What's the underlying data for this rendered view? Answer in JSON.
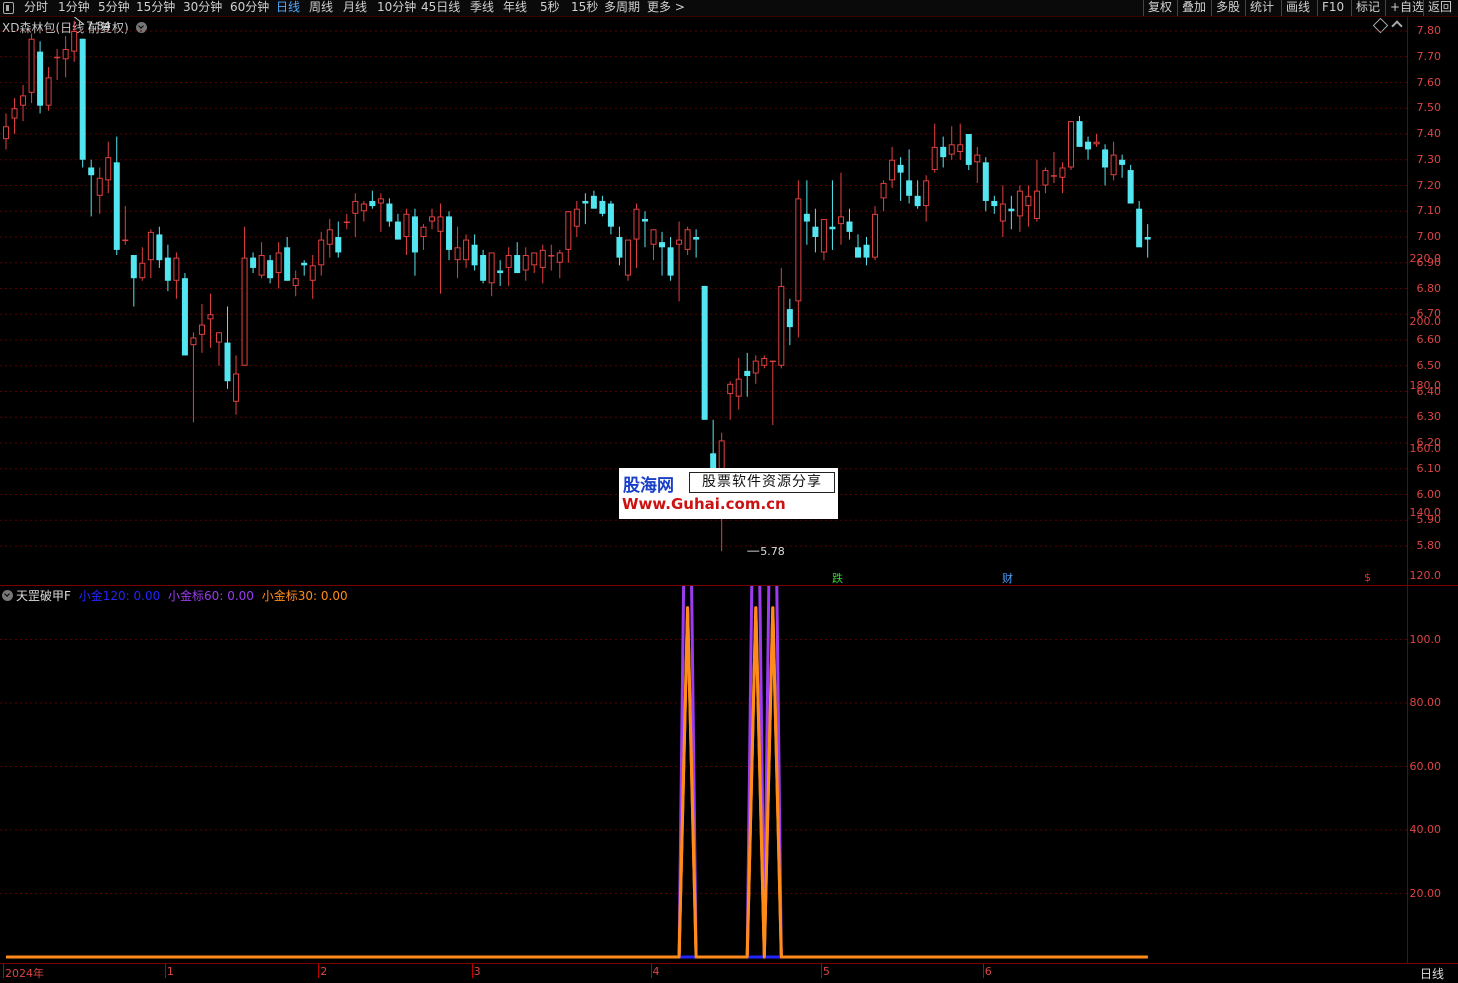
{
  "toolbar": {
    "tabs": [
      "分时",
      "1分钟",
      "5分钟",
      "15分钟",
      "30分钟",
      "60分钟",
      "日线",
      "周线",
      "月线",
      "10分钟",
      "45日线",
      "季线",
      "年线",
      "5秒",
      "15秒",
      "多周期",
      "更多 >"
    ],
    "active_tab": "日线",
    "right_buttons": [
      "复权",
      "叠加",
      "多股",
      "统计",
      "画线",
      "F10",
      "标记",
      "+自选",
      "返回"
    ]
  },
  "main_panel": {
    "title": "XD森林包(日线 前复权)",
    "high_label": "7.84",
    "low_label": "5.78",
    "badges": {
      "die": "跌",
      "cai": "财",
      "dollar": "$"
    },
    "y_ticks": [
      "7.80",
      "7.70",
      "7.60",
      "7.50",
      "7.40",
      "7.30",
      "7.20",
      "7.10",
      "7.00",
      "6.90",
      "6.80",
      "6.70",
      "6.60",
      "6.50",
      "6.40",
      "6.30",
      "6.20",
      "6.10",
      "6.00",
      "5.90",
      "5.80"
    ],
    "colors": {
      "up": "#e04040",
      "down": "#54e6f0",
      "grid": "#5a0000"
    }
  },
  "candles": [
    [
      7.38,
      7.48,
      7.34,
      7.43
    ],
    [
      7.46,
      7.54,
      7.4,
      7.5
    ],
    [
      7.51,
      7.59,
      7.45,
      7.55
    ],
    [
      7.56,
      7.79,
      7.52,
      7.77
    ],
    [
      7.72,
      7.76,
      7.48,
      7.51
    ],
    [
      7.51,
      7.66,
      7.49,
      7.62
    ],
    [
      7.7,
      7.73,
      7.61,
      7.7
    ],
    [
      7.69,
      7.78,
      7.62,
      7.73
    ],
    [
      7.72,
      7.84,
      7.68,
      7.8
    ],
    [
      7.77,
      7.77,
      7.27,
      7.3
    ],
    [
      7.27,
      7.3,
      7.08,
      7.24
    ],
    [
      7.16,
      7.27,
      7.09,
      7.23
    ],
    [
      7.22,
      7.37,
      7.17,
      7.31
    ],
    [
      7.29,
      7.39,
      6.93,
      6.95
    ],
    [
      6.99,
      7.12,
      6.97,
      6.99
    ],
    [
      6.93,
      6.93,
      6.73,
      6.84
    ],
    [
      6.84,
      6.96,
      6.83,
      6.9
    ],
    [
      6.91,
      7.03,
      6.84,
      7.02
    ],
    [
      7.01,
      7.04,
      6.88,
      6.91
    ],
    [
      6.92,
      6.97,
      6.79,
      6.83
    ],
    [
      6.83,
      6.94,
      6.76,
      6.92
    ],
    [
      6.84,
      6.86,
      6.55,
      6.54
    ],
    [
      6.58,
      6.63,
      6.28,
      6.61
    ],
    [
      6.62,
      6.74,
      6.55,
      6.66
    ],
    [
      6.68,
      6.78,
      6.57,
      6.7
    ],
    [
      6.59,
      6.63,
      6.5,
      6.63
    ],
    [
      6.59,
      6.73,
      6.41,
      6.44
    ],
    [
      6.36,
      6.54,
      6.31,
      6.47
    ],
    [
      6.5,
      7.04,
      6.5,
      6.92
    ],
    [
      6.92,
      6.94,
      6.86,
      6.88
    ],
    [
      6.85,
      6.98,
      6.84,
      6.93
    ],
    [
      6.91,
      6.93,
      6.82,
      6.84
    ],
    [
      6.86,
      6.98,
      6.8,
      6.94
    ],
    [
      6.96,
      7.0,
      6.83,
      6.83
    ],
    [
      6.81,
      6.87,
      6.77,
      6.84
    ],
    [
      6.9,
      6.91,
      6.85,
      6.89
    ],
    [
      6.83,
      6.93,
      6.76,
      6.89
    ],
    [
      6.89,
      7.02,
      6.85,
      6.99
    ],
    [
      6.97,
      7.07,
      6.92,
      7.03
    ],
    [
      7.0,
      7.06,
      6.92,
      6.94
    ],
    [
      7.06,
      7.09,
      7.03,
      7.06
    ],
    [
      7.09,
      7.17,
      7.0,
      7.14
    ],
    [
      7.1,
      7.14,
      7.06,
      7.13
    ],
    [
      7.14,
      7.18,
      7.11,
      7.12
    ],
    [
      7.13,
      7.17,
      7.02,
      7.15
    ],
    [
      7.13,
      7.15,
      7.04,
      7.06
    ],
    [
      7.06,
      7.09,
      6.99,
      6.99
    ],
    [
      7.0,
      7.11,
      6.93,
      7.09
    ],
    [
      7.08,
      7.11,
      6.85,
      6.94
    ],
    [
      7.0,
      7.05,
      6.95,
      7.04
    ],
    [
      7.06,
      7.11,
      7.03,
      7.08
    ],
    [
      7.02,
      7.13,
      6.78,
      7.08
    ],
    [
      7.08,
      7.1,
      6.91,
      6.95
    ],
    [
      6.91,
      7.04,
      6.84,
      6.96
    ],
    [
      6.91,
      7.01,
      6.88,
      6.99
    ],
    [
      6.97,
      7.01,
      6.87,
      6.89
    ],
    [
      6.93,
      6.95,
      6.82,
      6.83
    ],
    [
      6.82,
      6.94,
      6.77,
      6.94
    ],
    [
      6.87,
      6.91,
      6.81,
      6.86
    ],
    [
      6.88,
      6.96,
      6.81,
      6.93
    ],
    [
      6.93,
      6.98,
      6.86,
      6.86
    ],
    [
      6.87,
      6.96,
      6.83,
      6.93
    ],
    [
      6.89,
      6.94,
      6.86,
      6.94
    ],
    [
      6.88,
      6.97,
      6.82,
      6.95
    ],
    [
      6.93,
      6.97,
      6.87,
      6.93
    ],
    [
      6.9,
      6.95,
      6.84,
      6.94
    ],
    [
      6.95,
      7.1,
      6.9,
      7.1
    ],
    [
      7.04,
      7.14,
      7.0,
      7.11
    ],
    [
      7.14,
      7.17,
      7.05,
      7.13
    ],
    [
      7.16,
      7.18,
      7.11,
      7.11
    ],
    [
      7.14,
      7.16,
      7.08,
      7.09
    ],
    [
      7.13,
      7.14,
      7.01,
      7.04
    ],
    [
      7.0,
      7.04,
      6.89,
      6.92
    ],
    [
      6.85,
      6.95,
      6.83,
      6.99
    ],
    [
      6.99,
      7.13,
      6.88,
      7.11
    ],
    [
      7.07,
      7.1,
      6.96,
      7.06
    ],
    [
      6.97,
      7.03,
      6.91,
      7.03
    ],
    [
      6.98,
      7.02,
      6.85,
      6.96
    ],
    [
      6.96,
      7.0,
      6.83,
      6.85
    ],
    [
      6.97,
      7.06,
      6.75,
      6.99
    ],
    [
      6.95,
      7.04,
      6.93,
      7.03
    ],
    [
      7.0,
      7.03,
      6.92,
      6.99
    ],
    [
      6.81,
      6.81,
      6.31,
      6.29
    ],
    [
      6.16,
      6.29,
      6.04,
      6.1
    ],
    [
      5.97,
      6.24,
      5.78,
      6.21
    ],
    [
      6.39,
      6.44,
      6.29,
      6.43
    ],
    [
      6.38,
      6.53,
      6.33,
      6.45
    ],
    [
      6.48,
      6.55,
      6.38,
      6.46
    ],
    [
      6.47,
      6.54,
      6.43,
      6.52
    ],
    [
      6.5,
      6.54,
      6.49,
      6.53
    ],
    [
      6.52,
      6.52,
      6.27,
      6.52
    ],
    [
      6.5,
      6.88,
      6.49,
      6.81
    ],
    [
      6.72,
      6.76,
      6.58,
      6.65
    ],
    [
      6.75,
      7.22,
      6.61,
      7.15
    ],
    [
      7.09,
      7.22,
      6.97,
      7.06
    ],
    [
      7.04,
      7.11,
      6.94,
      7.0
    ],
    [
      6.94,
      7.04,
      6.91,
      7.07
    ],
    [
      7.04,
      7.22,
      6.95,
      7.03
    ],
    [
      7.05,
      7.25,
      6.97,
      7.08
    ],
    [
      7.06,
      7.11,
      6.99,
      7.02
    ],
    [
      6.96,
      7.01,
      6.92,
      6.92
    ],
    [
      6.97,
      7.0,
      6.89,
      6.92
    ],
    [
      6.92,
      7.12,
      6.91,
      7.09
    ],
    [
      7.15,
      7.22,
      7.1,
      7.21
    ],
    [
      7.22,
      7.35,
      7.19,
      7.3
    ],
    [
      7.28,
      7.31,
      7.14,
      7.25
    ],
    [
      7.22,
      7.34,
      7.13,
      7.16
    ],
    [
      7.16,
      7.22,
      7.11,
      7.12
    ],
    [
      7.12,
      7.24,
      7.06,
      7.22
    ],
    [
      7.26,
      7.44,
      7.25,
      7.35
    ],
    [
      7.35,
      7.39,
      7.27,
      7.31
    ],
    [
      7.32,
      7.43,
      7.3,
      7.36
    ],
    [
      7.33,
      7.44,
      7.3,
      7.36
    ],
    [
      7.4,
      7.4,
      7.26,
      7.28
    ],
    [
      7.29,
      7.35,
      7.21,
      7.32
    ],
    [
      7.29,
      7.31,
      7.1,
      7.14
    ],
    [
      7.14,
      7.16,
      7.09,
      7.12
    ],
    [
      7.06,
      7.2,
      7.0,
      7.13
    ],
    [
      7.11,
      7.16,
      7.03,
      7.1
    ],
    [
      7.08,
      7.2,
      7.02,
      7.18
    ],
    [
      7.12,
      7.2,
      7.04,
      7.16
    ],
    [
      7.07,
      7.3,
      7.06,
      7.18
    ],
    [
      7.2,
      7.27,
      7.17,
      7.26
    ],
    [
      7.24,
      7.33,
      7.21,
      7.24
    ],
    [
      7.23,
      7.29,
      7.17,
      7.27
    ],
    [
      7.27,
      7.45,
      7.26,
      7.45
    ],
    [
      7.45,
      7.47,
      7.35,
      7.35
    ],
    [
      7.37,
      7.39,
      7.3,
      7.34
    ],
    [
      7.36,
      7.4,
      7.35,
      7.37
    ],
    [
      7.34,
      7.36,
      7.2,
      7.27
    ],
    [
      7.24,
      7.37,
      7.22,
      7.32
    ],
    [
      7.3,
      7.32,
      7.23,
      7.28
    ],
    [
      7.26,
      7.28,
      7.15,
      7.13
    ],
    [
      7.11,
      7.14,
      6.99,
      6.96
    ],
    [
      7.0,
      7.05,
      6.92,
      6.99
    ]
  ],
  "sub_panel": {
    "title": "天罡破甲F",
    "series": [
      {
        "name": "小金120",
        "value_text": "0.00",
        "color": "#2424ff"
      },
      {
        "name": "小金标60",
        "value_text": "0.00",
        "color": "#9b3cf0"
      },
      {
        "name": "小金标30",
        "value_text": "0.00",
        "color": "#ff8c1a"
      }
    ],
    "y_ticks": [
      "220.0",
      "200.0",
      "180.0",
      "160.0",
      "140.0",
      "120.0",
      "100.0",
      "80.00",
      "60.00",
      "40.00",
      "20.00"
    ]
  },
  "chart_data": {
    "type": "line",
    "x": [
      79,
      80,
      81,
      82,
      83,
      87,
      88,
      89,
      90,
      91,
      92
    ],
    "series": [
      {
        "name": "小金120",
        "values": [
          0,
          0,
          0,
          0,
          0,
          0,
          0,
          0,
          0,
          0,
          0
        ]
      },
      {
        "name": "小金标60",
        "values": [
          0,
          220,
          0,
          0,
          0,
          0,
          220,
          0,
          220,
          0,
          0
        ]
      },
      {
        "name": "小金标30",
        "values": [
          0,
          110,
          0,
          0,
          0,
          0,
          110,
          0,
          110,
          0,
          0
        ]
      }
    ],
    "ylim": [
      0,
      230
    ]
  },
  "x_axis": {
    "labels": [
      {
        "text": "2024年",
        "idx": 0
      },
      {
        "text": "1",
        "idx": 19
      },
      {
        "text": "2",
        "idx": 37
      },
      {
        "text": "3",
        "idx": 55
      },
      {
        "text": "4",
        "idx": 76
      },
      {
        "text": "5",
        "idx": 96
      },
      {
        "text": "6",
        "idx": 115
      }
    ],
    "period_label": "日线"
  },
  "watermark": {
    "brand": "股海网",
    "slogan": "股票软件资源分享",
    "url": "Www.Guhai.com.cn"
  }
}
